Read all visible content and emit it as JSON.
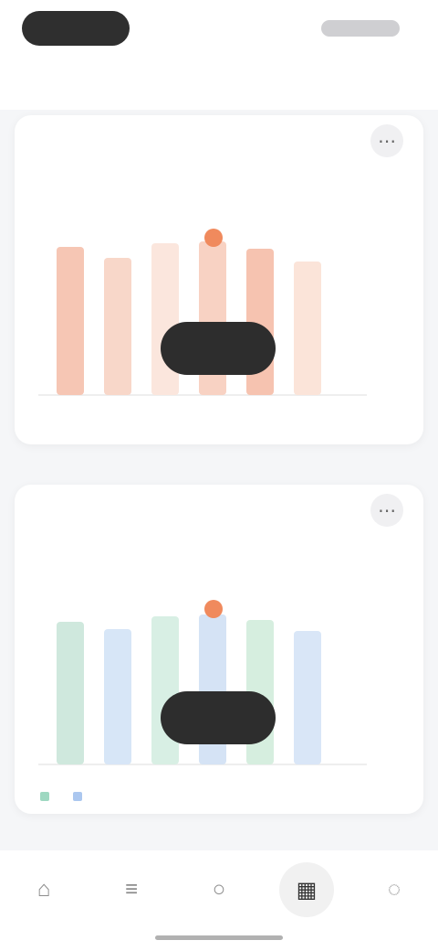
{
  "status_bar": {
    "left_label": "",
    "right_label": ""
  },
  "header": {
    "title": ""
  },
  "cards": [
    {
      "title": "",
      "subtitle": "",
      "tooltip_text": "",
      "pill_label": "",
      "foot_text": "",
      "icon": "more-horizontal-icon",
      "accent": "#f08a5d",
      "bars": [
        {
          "color": "#f6c6b4"
        },
        {
          "color": "#f8d7c9"
        },
        {
          "color": "#fbe6dd"
        },
        {
          "color": "#f8d2c3"
        },
        {
          "color": "#f6c3b0"
        },
        {
          "color": "#fbe4d9"
        }
      ],
      "y_ticks": [
        "",
        "",
        "",
        "",
        "",
        ""
      ]
    },
    {
      "title": "",
      "subtitle": "",
      "tooltip_text": "",
      "pill_label": "",
      "foot_text": "",
      "icon": "more-horizontal-icon",
      "accent": "#f08a5d",
      "bars": [
        {
          "color": "#cfe8dd"
        },
        {
          "color": "#d7e6f7"
        },
        {
          "color": "#d8efe4"
        },
        {
          "color": "#d5e3f5"
        },
        {
          "color": "#d6eedf"
        },
        {
          "color": "#d9e6f7"
        }
      ],
      "legend": [
        "",
        ""
      ],
      "y_ticks": [
        "",
        "",
        "",
        "",
        "",
        ""
      ]
    }
  ],
  "section_note": "",
  "bottom_nav": [
    {
      "label": "",
      "icon": "home-icon",
      "active": false
    },
    {
      "label": "",
      "icon": "list-icon",
      "active": false
    },
    {
      "label": "",
      "icon": "circle-icon",
      "active": false
    },
    {
      "label": "",
      "icon": "chart-icon",
      "active": true
    },
    {
      "label": "",
      "icon": "user-icon",
      "active": false
    }
  ]
}
